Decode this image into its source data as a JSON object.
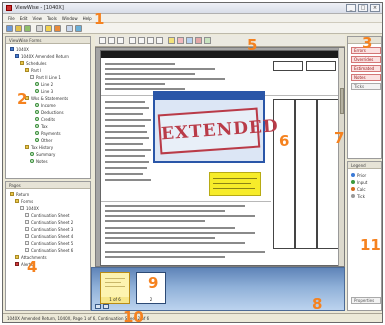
{
  "window": {
    "title": "ViewWise - [1040X]",
    "controls": [
      "_",
      "□",
      "×"
    ]
  },
  "menu": [
    "File",
    "Edit",
    "View",
    "Tools",
    "Window",
    "Help"
  ],
  "callouts": [
    "1",
    "2",
    "3",
    "4",
    "5",
    "6",
    "7",
    "8",
    "9",
    "10",
    "11"
  ],
  "left_top_panel": {
    "title": "ViewWise Forms",
    "tree": [
      {
        "label": "1040X",
        "icon": "form-icon"
      },
      {
        "label": "1040X Amended Return",
        "icon": "form-icon"
      },
      {
        "label": "Schedules",
        "icon": "folder-icon"
      },
      {
        "label": "Part I",
        "icon": "folder-icon"
      },
      {
        "label": "Part II Line 1",
        "icon": "doc-icon"
      },
      {
        "label": "Line 2",
        "icon": "ok-icon"
      },
      {
        "label": "Line 3",
        "icon": "ok-icon"
      },
      {
        "label": "Wks & Statements",
        "icon": "folder-icon"
      },
      {
        "label": "Income",
        "icon": "ok-icon"
      },
      {
        "label": "Deductions",
        "icon": "ok-icon"
      },
      {
        "label": "Credits",
        "icon": "ok-icon"
      },
      {
        "label": "Tax",
        "icon": "ok-icon"
      },
      {
        "label": "Payments",
        "icon": "ok-icon"
      },
      {
        "label": "Other",
        "icon": "ok-icon"
      },
      {
        "label": "Tax History",
        "icon": "folder-icon"
      },
      {
        "label": "Summary",
        "icon": "ok-icon"
      },
      {
        "label": "Notes",
        "icon": "ok-icon"
      }
    ]
  },
  "left_bottom_panel": {
    "title": "Pages",
    "tree": [
      {
        "label": "Return",
        "icon": "folder-icon"
      },
      {
        "label": "Forms",
        "icon": "folder-icon"
      },
      {
        "label": "1040X",
        "icon": "doc-icon"
      },
      {
        "label": "Continuation Sheet",
        "icon": "doc-icon"
      },
      {
        "label": "Continuation Sheet 2",
        "icon": "doc-icon"
      },
      {
        "label": "Continuation Sheet 3",
        "icon": "doc-icon"
      },
      {
        "label": "Continuation Sheet 4",
        "icon": "doc-icon"
      },
      {
        "label": "Continuation Sheet 5",
        "icon": "doc-icon"
      },
      {
        "label": "Continuation Sheet 6",
        "icon": "doc-icon"
      },
      {
        "label": "Attachments",
        "icon": "folder-icon"
      },
      {
        "label": "Alerts",
        "icon": "red-icon"
      }
    ]
  },
  "document": {
    "stamp_text": "EXTENDED"
  },
  "right_top_panel": {
    "items": [
      {
        "label": "Errors",
        "kind": "alert"
      },
      {
        "label": "Overrides",
        "kind": "alert"
      },
      {
        "label": "Estimated",
        "kind": "alert"
      },
      {
        "label": "Notes",
        "kind": "alert"
      },
      {
        "label": "Ticks",
        "kind": "plain"
      }
    ]
  },
  "right_bottom_panel": {
    "title": "Legend",
    "rows": [
      {
        "label": "Prior",
        "color": "#3b7ad6"
      },
      {
        "label": "Input",
        "color": "#3d9a3d"
      },
      {
        "label": "Calc",
        "color": "#d46b1e"
      },
      {
        "label": "Tick",
        "color": "#999999"
      }
    ],
    "button_label": "Properties"
  },
  "thumbnails": [
    {
      "label": "1 of 6",
      "selected": true
    },
    {
      "label": "2",
      "selected": false
    }
  ],
  "status": {
    "text": "1040X Amended Return, 1040X, Page 1 of 6, Continuation Sheet 2 of 6"
  },
  "colors": {
    "callout": "#f5821f",
    "stamp": "#b93b48",
    "sticky": "#f7ec2a",
    "dialog": "#2a56a8"
  }
}
